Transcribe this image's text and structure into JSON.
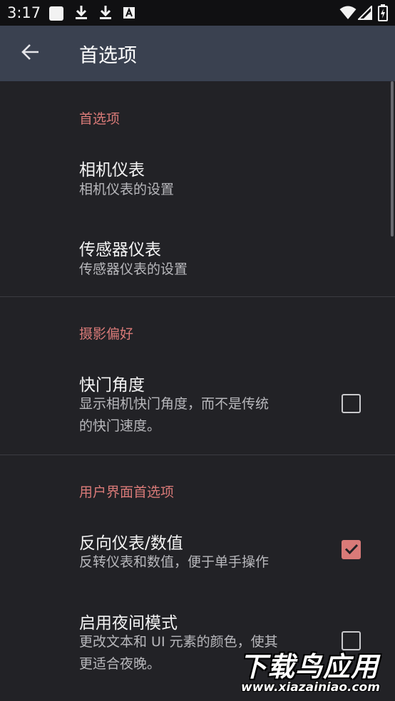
{
  "status_bar": {
    "time": "3:17",
    "icons": [
      "square-notification-icon",
      "download-icon",
      "download-icon",
      "a-box-icon",
      "wifi-icon",
      "signal-icon",
      "battery-charging-icon"
    ]
  },
  "app_bar": {
    "title": "首选项",
    "back_icon": "arrow-back-icon"
  },
  "sections": [
    {
      "title": "首选项",
      "items": [
        {
          "title": "相机仪表",
          "summary": "相机仪表的设置"
        },
        {
          "title": "传感器仪表",
          "summary": "传感器仪表的设置"
        }
      ]
    },
    {
      "title": "摄影偏好",
      "items": [
        {
          "title": "快门角度",
          "summary_line1": "显示相机快门角度，而不是传统",
          "summary_line2": "的快门速度。",
          "checked": false
        }
      ]
    },
    {
      "title": "用户界面首选项",
      "items": [
        {
          "title": "反向仪表/数值",
          "summary": "反转仪表和数值，便于单手操作",
          "checked": true
        },
        {
          "title": "启用夜间模式",
          "summary_line1": "更改文本和 UI 元素的颜色，使其",
          "summary_line2": "更适合夜晚。",
          "checked": false
        }
      ]
    }
  ],
  "watermark": {
    "main": "下载鸟应用",
    "url": "www.xiazainiao.com"
  },
  "colors": {
    "accent": "#d97a78",
    "app_bar": "#3a4150",
    "background": "#222226"
  }
}
